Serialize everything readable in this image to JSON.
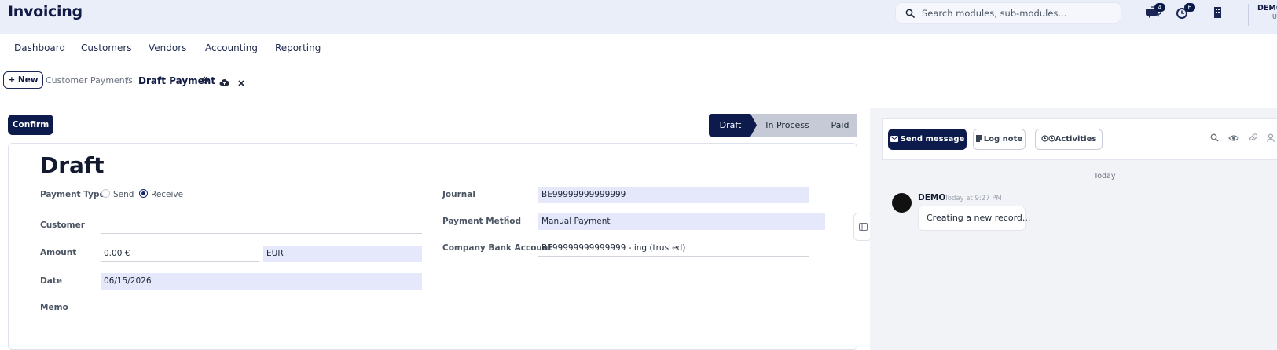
{
  "app": {
    "title": "Invoicing"
  },
  "search": {
    "placeholder": "Search modules, sub-modules..."
  },
  "systray": {
    "messages_count": "4",
    "activities_count": "6"
  },
  "user": {
    "name": "DEMO",
    "company_initial": "U"
  },
  "menu": {
    "items": [
      "Dashboard",
      "Customers",
      "Vendors",
      "Accounting",
      "Reporting"
    ]
  },
  "control_panel": {
    "new_label": "+ New",
    "breadcrumb_parent": "Customer Payments",
    "breadcrumb_separator": "/",
    "breadcrumb_current": "Draft Payment"
  },
  "form": {
    "confirm_label": "Confirm",
    "status": {
      "stages": [
        "Draft",
        "In Process",
        "Paid"
      ],
      "active": "Draft"
    },
    "record_title": "Draft",
    "payment_type": {
      "label": "Payment Type",
      "options": [
        "Send",
        "Receive"
      ],
      "selected": "Receive"
    },
    "customer": {
      "label": "Customer",
      "value": ""
    },
    "amount": {
      "label": "Amount",
      "value": "0.00 €",
      "currency": "EUR"
    },
    "date": {
      "label": "Date",
      "value": "06/15/2026"
    },
    "memo": {
      "label": "Memo",
      "value": ""
    },
    "journal": {
      "label": "Journal",
      "value": "BE99999999999999"
    },
    "payment_method": {
      "label": "Payment Method",
      "help": "?",
      "value": "Manual Payment"
    },
    "company_bank_account": {
      "label": "Company Bank Account",
      "value": "BE99999999999999 - ing (trusted)"
    }
  },
  "chatter": {
    "send_message_label": "Send message",
    "log_note_label": "Log note",
    "activities_label": "Activities",
    "date_separator": "Today",
    "messages": [
      {
        "author": "DEMO",
        "time": "Today at 9:27 PM",
        "body": "Creating a new record..."
      }
    ]
  },
  "colors": {
    "navbar_bg": "#eaeef9",
    "primary": "#0d1b4c",
    "highlight_field": "#e5e7fb",
    "status_inactive": "#c5cad6"
  }
}
